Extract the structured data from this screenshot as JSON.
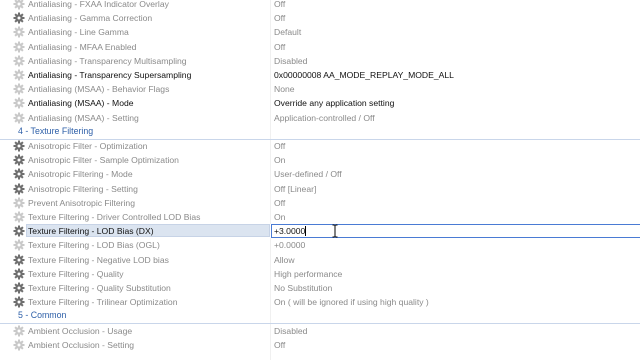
{
  "rows": [
    {
      "type": "setting",
      "icon": "gear-faded",
      "name": "Antialiasing - FXAA Indicator Overlay",
      "value": "Off"
    },
    {
      "type": "setting",
      "icon": "gear",
      "name": "Antialiasing - Gamma Correction",
      "value": "Off"
    },
    {
      "type": "setting",
      "icon": "gear-faded",
      "name": "Antialiasing - Line Gamma",
      "value": "Default"
    },
    {
      "type": "setting",
      "icon": "gear-faded",
      "name": "Antialiasing - MFAA Enabled",
      "value": "Off"
    },
    {
      "type": "setting",
      "icon": "gear-faded",
      "name": "Antialiasing - Transparency Multisampling",
      "value": "Disabled"
    },
    {
      "type": "setting",
      "icon": "gear-faded",
      "name": "Antialiasing - Transparency Supersampling",
      "value": "0x00000008 AA_MODE_REPLAY_MODE_ALL",
      "modified": true
    },
    {
      "type": "setting",
      "icon": "gear-faded",
      "name": "Antialiasing (MSAA) - Behavior Flags",
      "value": "None"
    },
    {
      "type": "setting",
      "icon": "gear-faded",
      "name": "Antialiasing (MSAA) - Mode",
      "value": "Override any application setting",
      "modified": true
    },
    {
      "type": "setting",
      "icon": "gear-faded",
      "name": "Antialiasing (MSAA) - Setting",
      "value": "Application-controlled / Off"
    },
    {
      "type": "section",
      "title": "4 - Texture Filtering"
    },
    {
      "type": "setting",
      "icon": "gear",
      "name": "Anisotropic Filter - Optimization",
      "value": "Off"
    },
    {
      "type": "setting",
      "icon": "gear",
      "name": "Anisotropic Filter - Sample Optimization",
      "value": "On"
    },
    {
      "type": "setting",
      "icon": "gear",
      "name": "Anisotropic Filtering - Mode",
      "value": "User-defined / Off"
    },
    {
      "type": "setting",
      "icon": "gear",
      "name": "Anisotropic Filtering - Setting",
      "value": "Off [Linear]"
    },
    {
      "type": "setting",
      "icon": "gear-faded",
      "name": "Prevent Anisotropic Filtering",
      "value": "Off"
    },
    {
      "type": "setting",
      "icon": "gear-faded",
      "name": "Texture Filtering - Driver Controlled LOD Bias",
      "value": "On"
    },
    {
      "type": "setting",
      "icon": "gear",
      "name": "Texture Filtering - LOD Bias (DX)",
      "value": "+3.0000",
      "selected": true
    },
    {
      "type": "setting",
      "icon": "gear-faded",
      "name": "Texture Filtering - LOD Bias (OGL)",
      "value": "+0.0000"
    },
    {
      "type": "setting",
      "icon": "gear",
      "name": "Texture Filtering - Negative LOD bias",
      "value": "Allow"
    },
    {
      "type": "setting",
      "icon": "gear",
      "name": "Texture Filtering - Quality",
      "value": "High performance"
    },
    {
      "type": "setting",
      "icon": "gear",
      "name": "Texture Filtering - Quality Substitution",
      "value": "No Substitution"
    },
    {
      "type": "setting",
      "icon": "gear",
      "name": "Texture Filtering - Trilinear Optimization",
      "value": "On ( will be ignored if using high quality )"
    },
    {
      "type": "section",
      "title": "5 - Common"
    },
    {
      "type": "setting",
      "icon": "gear-faded",
      "name": "Ambient Occlusion - Usage",
      "value": "Disabled"
    },
    {
      "type": "setting",
      "icon": "gear-faded",
      "name": "Ambient Occlusion - Setting",
      "value": "Off"
    }
  ]
}
